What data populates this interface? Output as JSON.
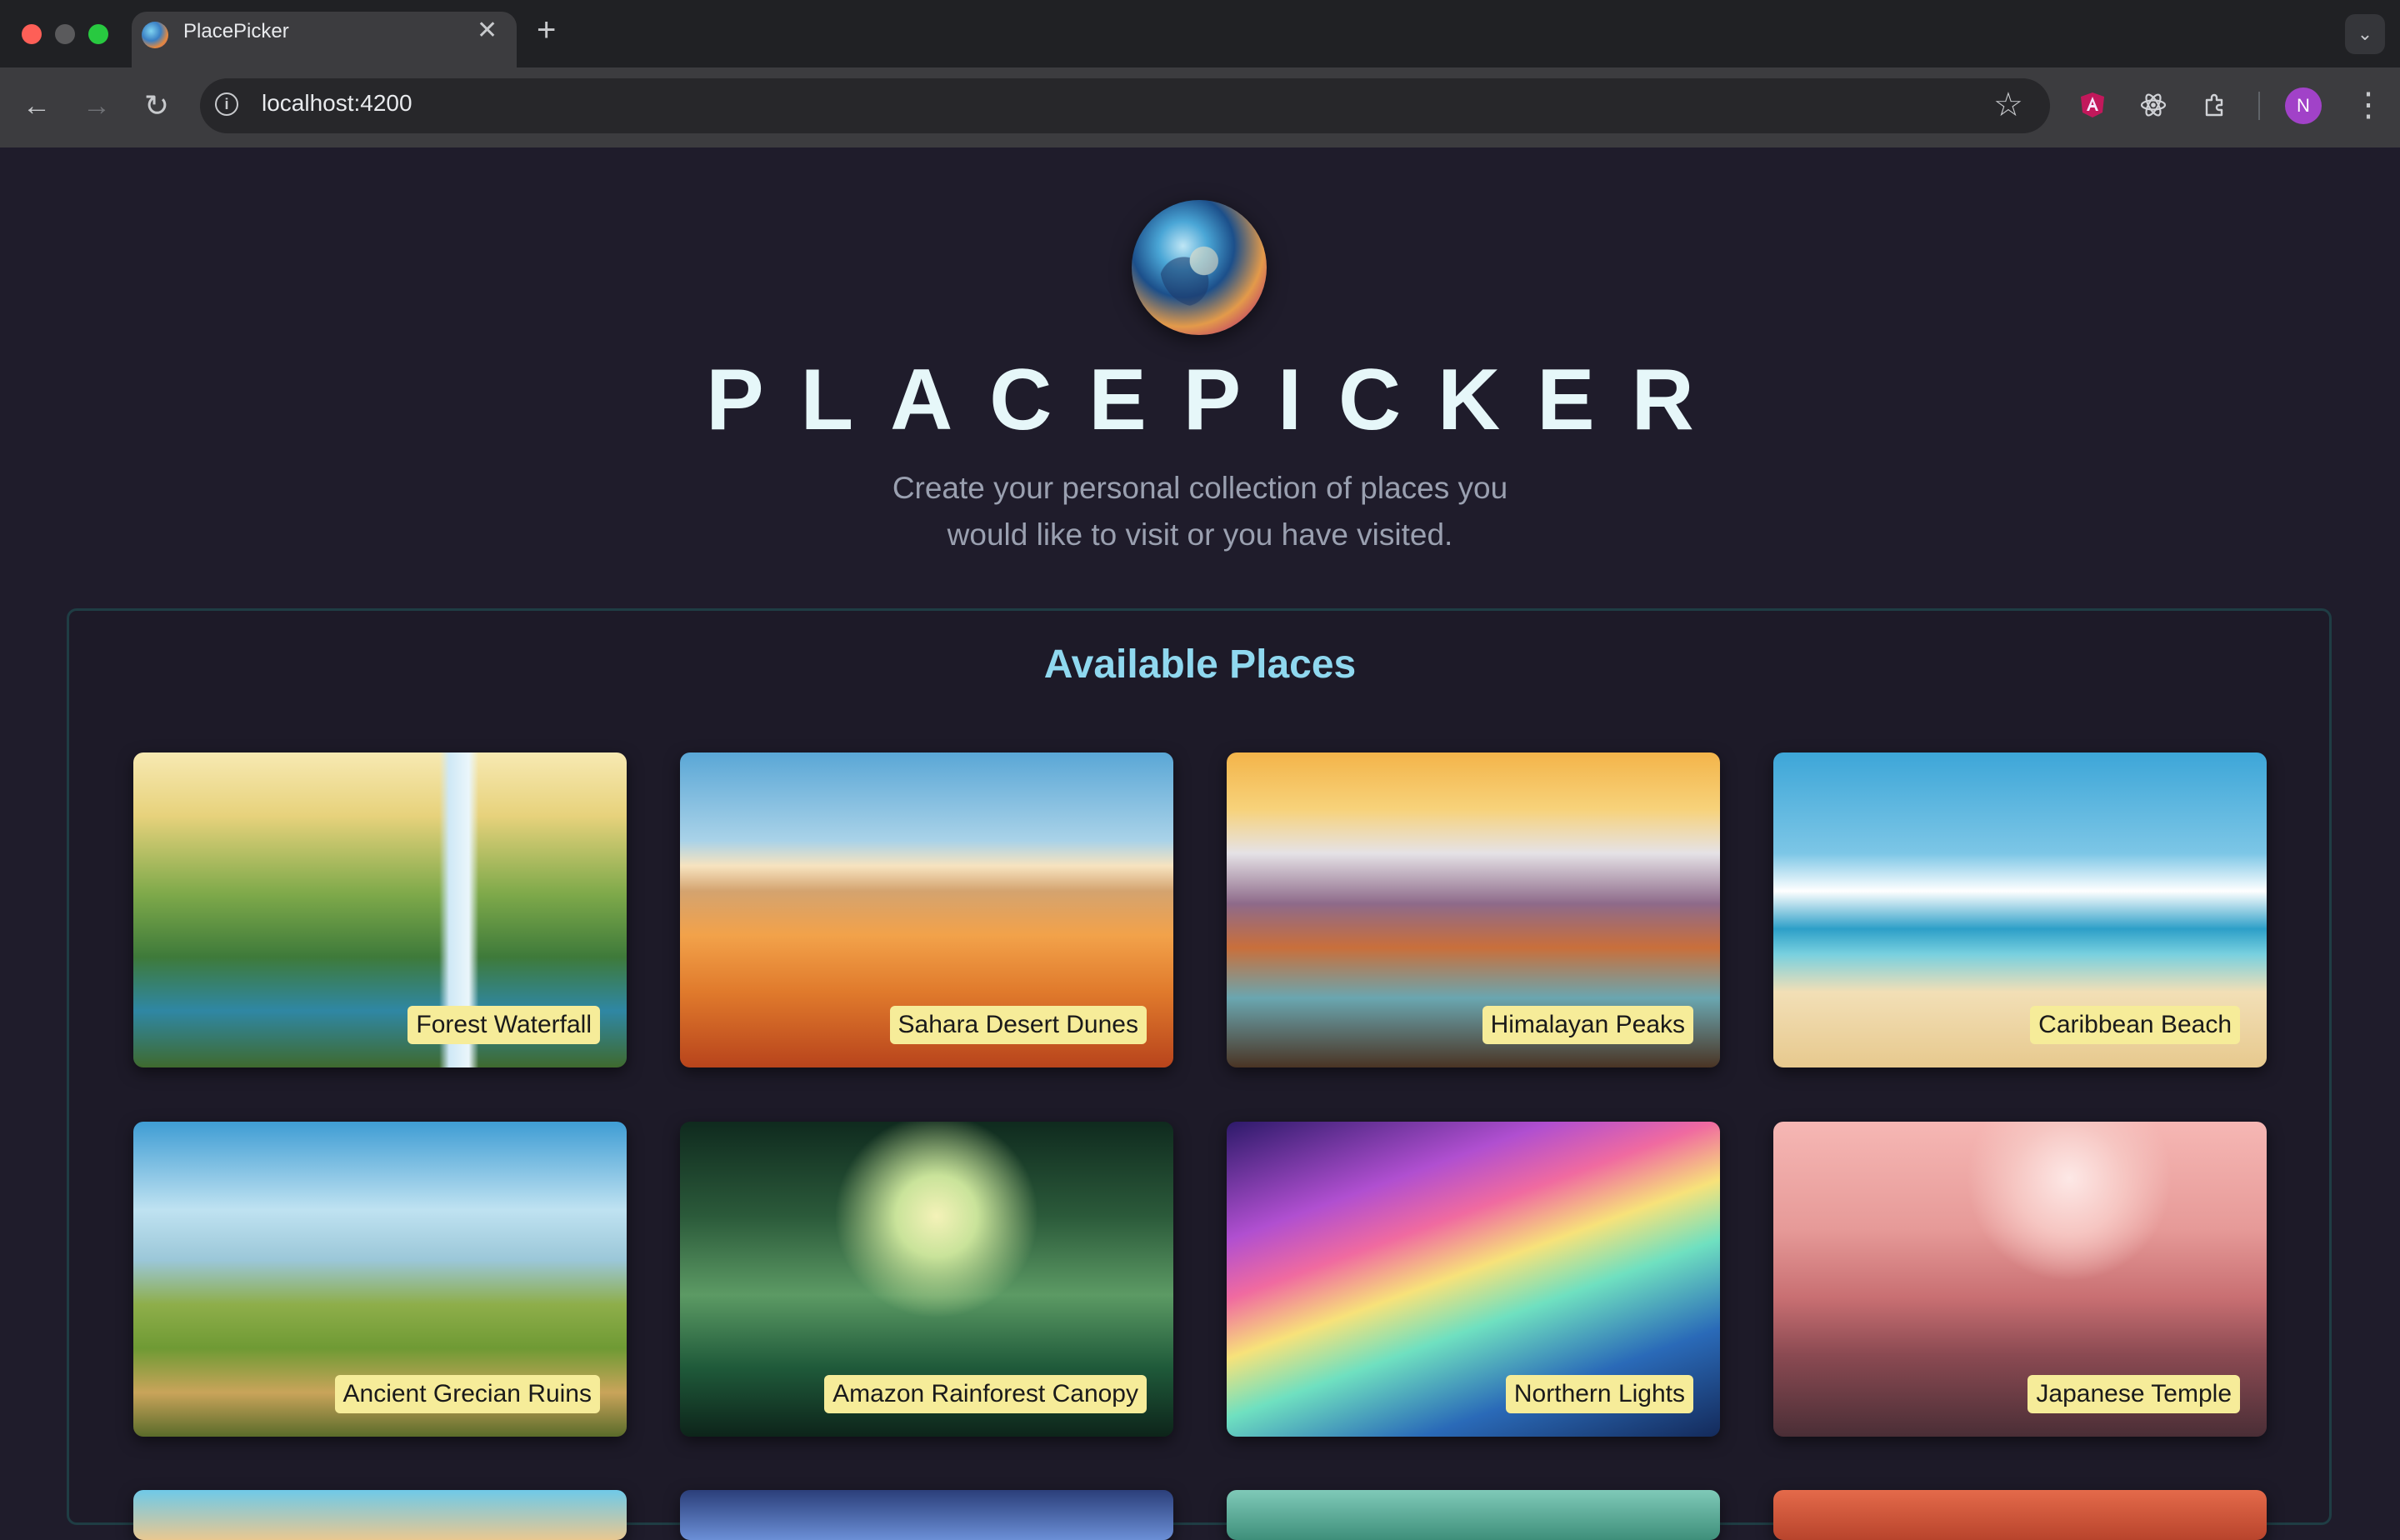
{
  "browser": {
    "tab_title": "PlacePicker",
    "tab_close": "✕",
    "new_tab": "+",
    "tab_menu": "⌄",
    "url": "localhost:4200",
    "back": "←",
    "forward": "→",
    "reload": "↻",
    "site_info": "i",
    "bookmark": "☆",
    "profile_initial": "N",
    "menu": "⋮"
  },
  "app": {
    "title": "PLACEPICKER",
    "subtitle": "Create your personal collection of places you would like to visit or you have visited."
  },
  "available_places": {
    "heading": "Available Places",
    "places": [
      {
        "title": "Forest Waterfall"
      },
      {
        "title": "Sahara Desert Dunes"
      },
      {
        "title": "Himalayan Peaks"
      },
      {
        "title": "Caribbean Beach"
      },
      {
        "title": "Ancient Grecian Ruins"
      },
      {
        "title": "Amazon Rainforest Canopy"
      },
      {
        "title": "Northern Lights"
      },
      {
        "title": "Japanese Temple"
      }
    ]
  },
  "colors": {
    "page_background": "#1f1c2b",
    "heading_accent": "#8fd8ef",
    "label_background": "#f6ec99"
  }
}
